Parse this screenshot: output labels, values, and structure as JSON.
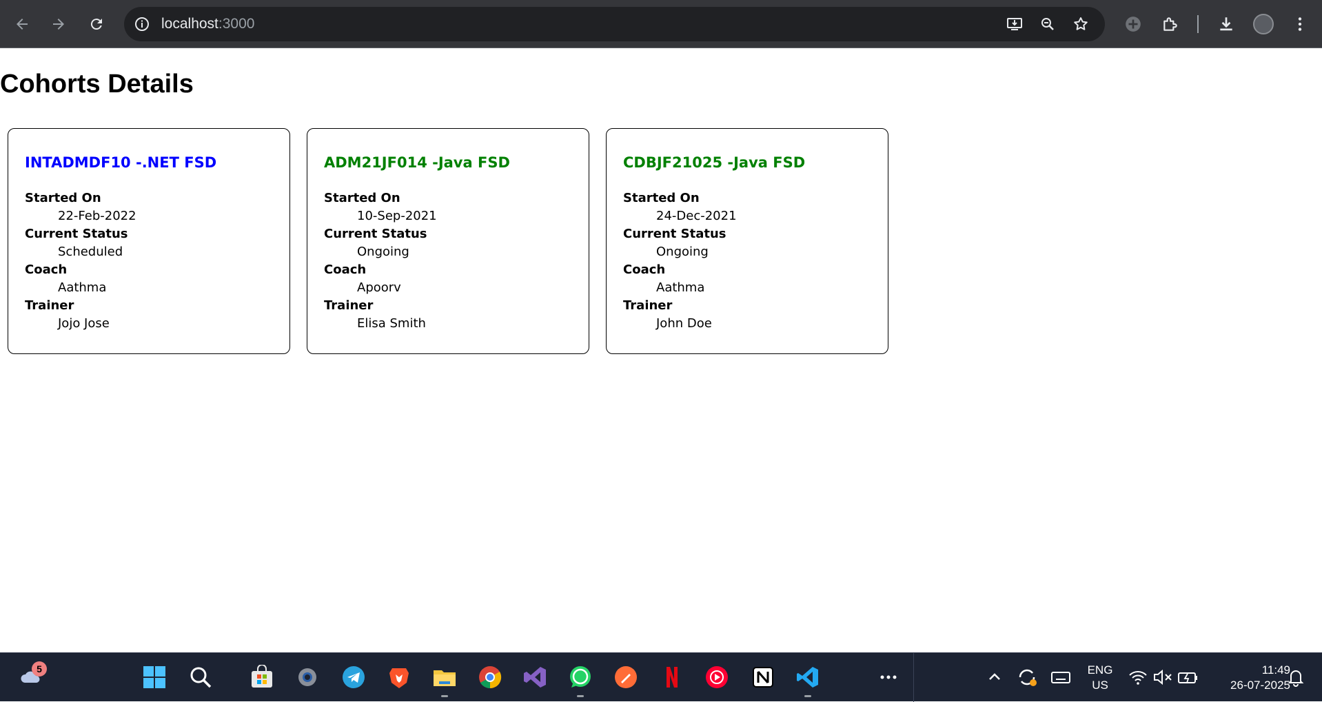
{
  "browser": {
    "url_host": "localhost",
    "url_port": ":3000"
  },
  "page": {
    "title": "Cohorts Details",
    "cohorts": [
      {
        "name": "INTADMDF10 -.NET FSD",
        "title_color": "#0000ff",
        "started_on_label": "Started On",
        "started_on": "22-Feb-2022",
        "status_label": "Current Status",
        "status": "Scheduled",
        "coach_label": "Coach",
        "coach": "Aathma",
        "trainer_label": "Trainer",
        "trainer": "Jojo Jose"
      },
      {
        "name": "ADM21JF014 -Java FSD",
        "title_color": "#008000",
        "started_on_label": "Started On",
        "started_on": "10-Sep-2021",
        "status_label": "Current Status",
        "status": "Ongoing",
        "coach_label": "Coach",
        "coach": "Apoorv",
        "trainer_label": "Trainer",
        "trainer": "Elisa Smith"
      },
      {
        "name": "CDBJF21025 -Java FSD",
        "title_color": "#008000",
        "started_on_label": "Started On",
        "started_on": "24-Dec-2021",
        "status_label": "Current Status",
        "status": "Ongoing",
        "coach_label": "Coach",
        "coach": "Aathma",
        "trainer_label": "Trainer",
        "trainer": "John Doe"
      }
    ]
  },
  "taskbar": {
    "weather_badge": "5",
    "language_line1": "ENG",
    "language_line2": "US",
    "time": "11:49",
    "date": "26-07-2025"
  }
}
